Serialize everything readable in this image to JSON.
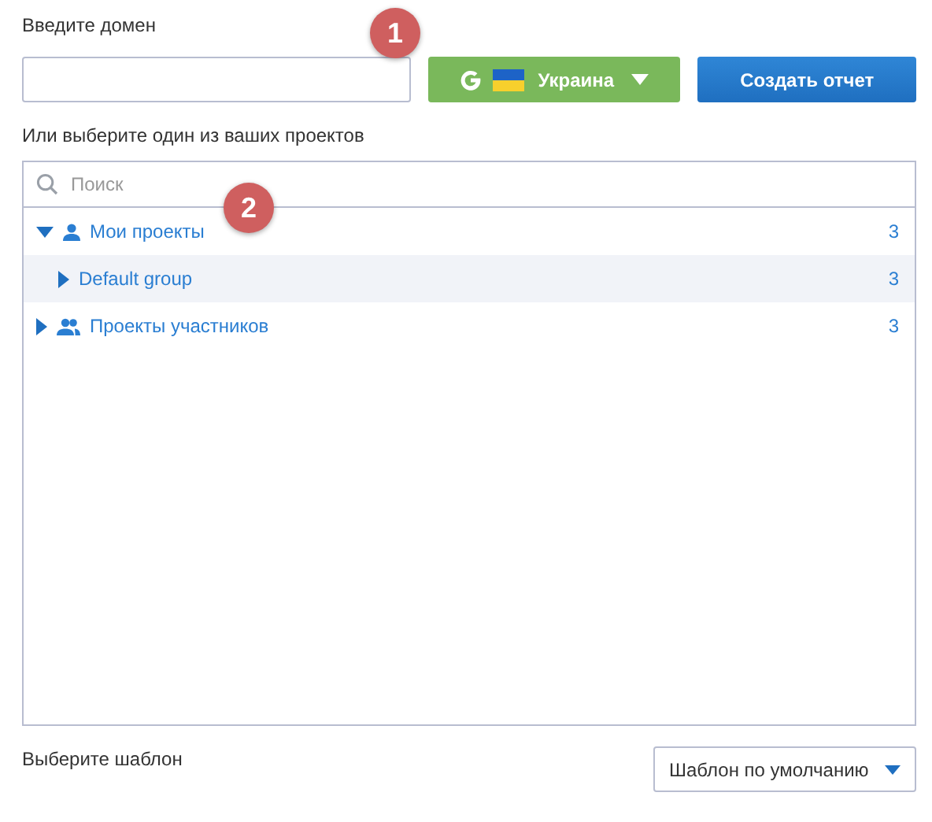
{
  "domain": {
    "label": "Введите домен"
  },
  "region_button": {
    "label": "Украина"
  },
  "create_button": {
    "label": "Создать отчет"
  },
  "projects_hint": "Или выберите один из ваших проектов",
  "tree": {
    "search": {
      "placeholder": "Поиск"
    },
    "items": [
      {
        "label": "Мои проекты",
        "kind": "user",
        "count": "3",
        "expanded": true,
        "selected": false,
        "children": [
          {
            "label": "Default group",
            "count": "3",
            "expanded": false,
            "selected": true
          }
        ]
      },
      {
        "label": "Проекты участников",
        "kind": "group",
        "count": "3",
        "expanded": false,
        "selected": false
      }
    ]
  },
  "template": {
    "label": "Выберите шаблон",
    "value": "Шаблон по умолчанию"
  },
  "callouts": [
    "1",
    "2"
  ]
}
